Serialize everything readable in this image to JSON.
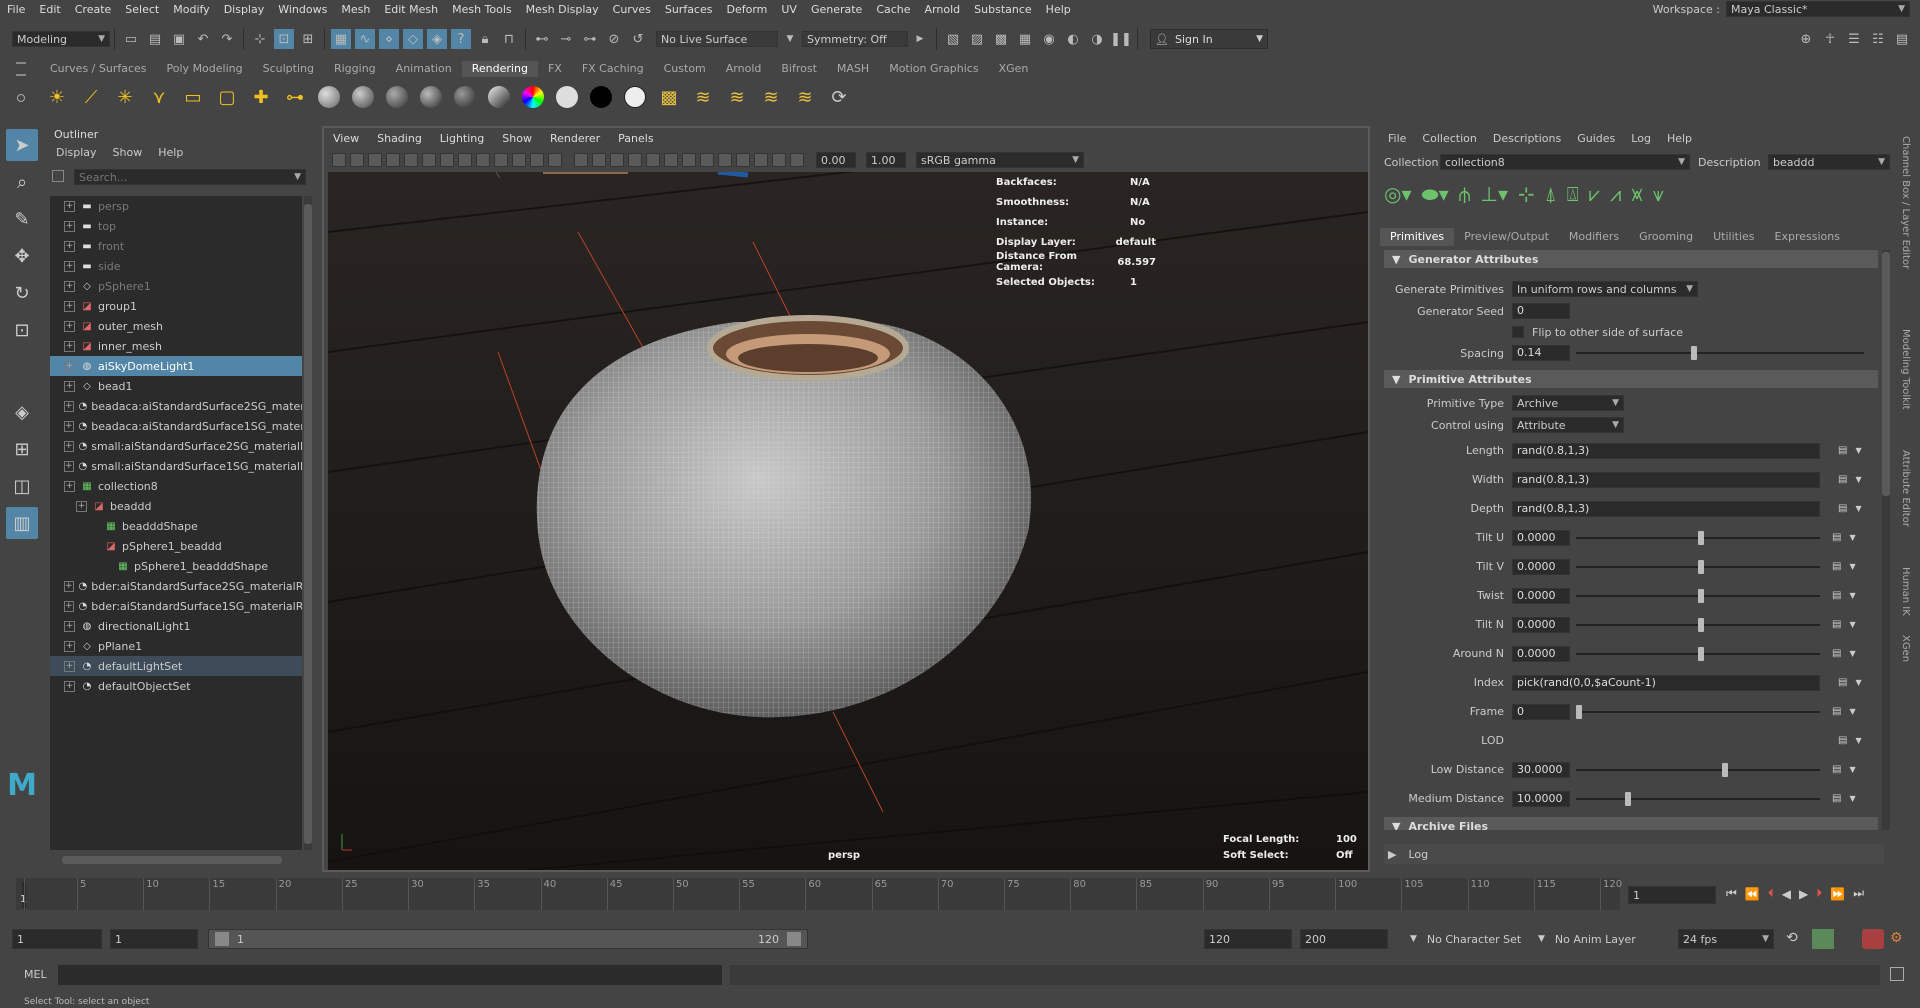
{
  "menubar": {
    "items": [
      "File",
      "Edit",
      "Create",
      "Select",
      "Modify",
      "Display",
      "Windows",
      "Mesh",
      "Edit Mesh",
      "Mesh Tools",
      "Mesh Display",
      "Curves",
      "Surfaces",
      "Deform",
      "UV",
      "Generate",
      "Cache",
      "Arnold",
      "Substance",
      "Help"
    ],
    "workspace_label": "Workspace :",
    "workspace_value": "Maya Classic*"
  },
  "status": {
    "mode": "Modeling",
    "live_surface": "No Live Surface",
    "symmetry": "Symmetry: Off",
    "sign_in": "Sign In"
  },
  "shelf": {
    "tabs": [
      "Curves / Surfaces",
      "Poly Modeling",
      "Sculpting",
      "Rigging",
      "Animation",
      "Rendering",
      "FX",
      "FX Caching",
      "Custom",
      "Arnold",
      "Bifrost",
      "MASH",
      "Motion Graphics",
      "XGen"
    ],
    "active": "Rendering"
  },
  "outliner": {
    "title": "Outliner",
    "menu": [
      "Display",
      "Show",
      "Help"
    ],
    "search_placeholder": "Search...",
    "items": [
      {
        "label": "persp",
        "indent": 0,
        "icon": "camera",
        "dim": true
      },
      {
        "label": "top",
        "indent": 0,
        "icon": "camera",
        "dim": true
      },
      {
        "label": "front",
        "indent": 0,
        "icon": "camera",
        "dim": true
      },
      {
        "label": "side",
        "indent": 0,
        "icon": "camera",
        "dim": true
      },
      {
        "label": "pSphere1",
        "indent": 0,
        "icon": "transform",
        "dim": true
      },
      {
        "label": "group1",
        "indent": 0,
        "icon": "group"
      },
      {
        "label": "outer_mesh",
        "indent": 0,
        "icon": "group"
      },
      {
        "label": "inner_mesh",
        "indent": 0,
        "icon": "group"
      },
      {
        "label": "aiSkyDomeLight1",
        "indent": 0,
        "icon": "light",
        "state": "selected"
      },
      {
        "label": "bead1",
        "indent": 0,
        "icon": "transform"
      },
      {
        "label": "beadaca:aiStandardSurface2SG_materia",
        "indent": 0,
        "icon": "set"
      },
      {
        "label": "beadaca:aiStandardSurface1SG_materia",
        "indent": 0,
        "icon": "set"
      },
      {
        "label": "small:aiStandardSurface2SG_materialR",
        "indent": 0,
        "icon": "set"
      },
      {
        "label": "small:aiStandardSurface1SG_materialR",
        "indent": 0,
        "icon": "set"
      },
      {
        "label": "collection8",
        "indent": 0,
        "icon": "xgen"
      },
      {
        "label": "beaddd",
        "indent": 1,
        "icon": "group"
      },
      {
        "label": "beadddShape",
        "indent": 2,
        "icon": "xgen"
      },
      {
        "label": "pSphere1_beaddd",
        "indent": 2,
        "icon": "group"
      },
      {
        "label": "pSphere1_beadddShape",
        "indent": 3,
        "icon": "xgen"
      },
      {
        "label": "bder:aiStandardSurface2SG_materialRe",
        "indent": 0,
        "icon": "set"
      },
      {
        "label": "bder:aiStandardSurface1SG_materialRe",
        "indent": 0,
        "icon": "set"
      },
      {
        "label": "directionalLight1",
        "indent": 0,
        "icon": "light"
      },
      {
        "label": "pPlane1",
        "indent": 0,
        "icon": "transform"
      },
      {
        "label": "defaultLightSet",
        "indent": 0,
        "icon": "set",
        "state": "highlight"
      },
      {
        "label": "defaultObjectSet",
        "indent": 0,
        "icon": "set"
      }
    ]
  },
  "viewport": {
    "menu": [
      "View",
      "Shading",
      "Lighting",
      "Show",
      "Renderer",
      "Panels"
    ],
    "exposure": "0.00",
    "gamma": "1.00",
    "color_space": "sRGB gamma",
    "hud": [
      {
        "k": "Backfaces:",
        "v": "N/A"
      },
      {
        "k": "Smoothness:",
        "v": "N/A"
      },
      {
        "k": "Instance:",
        "v": "No"
      },
      {
        "k": "Display Layer:",
        "v": "default"
      },
      {
        "k": "Distance From Camera:",
        "v": "68.597"
      },
      {
        "k": "Selected Objects:",
        "v": "1"
      }
    ],
    "camera_label": "persp",
    "focal_label": "Focal Length:",
    "focal_value": "100",
    "soft_label": "Soft Select:",
    "soft_value": "Off"
  },
  "xgen": {
    "menu": [
      "File",
      "Collection",
      "Descriptions",
      "Guides",
      "Log",
      "Help"
    ],
    "collection_label": "Collection",
    "collection": "collection8",
    "description_label": "Description",
    "description": "beaddd",
    "tabs": [
      "Primitives",
      "Preview/Output",
      "Modifiers",
      "Grooming",
      "Utilities",
      "Expressions"
    ],
    "active_tab": "Primitives",
    "gen_section": "Generator Attributes",
    "generate_primitives_label": "Generate Primitives",
    "generate_primitives": "In uniform rows and columns",
    "seed_label": "Generator Seed",
    "seed": "0",
    "flip_label": "Flip to other side of surface",
    "spacing_label": "Spacing",
    "spacing": "0.14",
    "prim_section": "Primitive Attributes",
    "ptype_label": "Primitive Type",
    "ptype": "Archive",
    "control_label": "Control using",
    "control": "Attribute",
    "attrs": [
      {
        "label": "Length",
        "value": "rand(0.8,1,3)",
        "slider": null
      },
      {
        "label": "Width",
        "value": "rand(0.8,1,3)",
        "slider": null
      },
      {
        "label": "Depth",
        "value": "rand(0.8,1,3)",
        "slider": null
      },
      {
        "label": "Tilt U",
        "value": "0.0000",
        "slider": 0.5
      },
      {
        "label": "Tilt V",
        "value": "0.0000",
        "slider": 0.5
      },
      {
        "label": "Twist",
        "value": "0.0000",
        "slider": 0.5
      },
      {
        "label": "Tilt N",
        "value": "0.0000",
        "slider": 0.5
      },
      {
        "label": "Around N",
        "value": "0.0000",
        "slider": 0.5
      },
      {
        "label": "Index",
        "value": "pick(rand(0,0,$aCount-1)",
        "slider": null
      },
      {
        "label": "Frame",
        "value": "0",
        "slider": 0.0
      },
      {
        "label": "LOD",
        "value": "",
        "slider": null
      },
      {
        "label": "Low Distance",
        "value": "30.0000",
        "slider": 0.6
      },
      {
        "label": "Medium Distance",
        "value": "10.0000",
        "slider": 0.2
      }
    ],
    "archive_section": "Archive Files",
    "log_label": "Log"
  },
  "right_tabs": [
    "Channel Box / Layer Editor",
    "Modeling Toolkit",
    "Attribute Editor",
    "Human IK",
    "XGen"
  ],
  "timeline": {
    "ticks": [
      "1",
      "5",
      "10",
      "15",
      "20",
      "25",
      "30",
      "35",
      "40",
      "45",
      "50",
      "55",
      "60",
      "65",
      "70",
      "75",
      "80",
      "85",
      "90",
      "95",
      "100",
      "105",
      "110",
      "115",
      "120"
    ],
    "current": "1"
  },
  "range": {
    "start": "1",
    "anim_start": "1",
    "slider_start": "1",
    "slider_end": "120",
    "end": "120",
    "anim_end": "200",
    "character_set": "No Character Set",
    "anim_layer": "No Anim Layer",
    "fps": "24 fps"
  },
  "cmd": {
    "lang": "MEL"
  },
  "help": {
    "text": "Select Tool: select an object"
  }
}
